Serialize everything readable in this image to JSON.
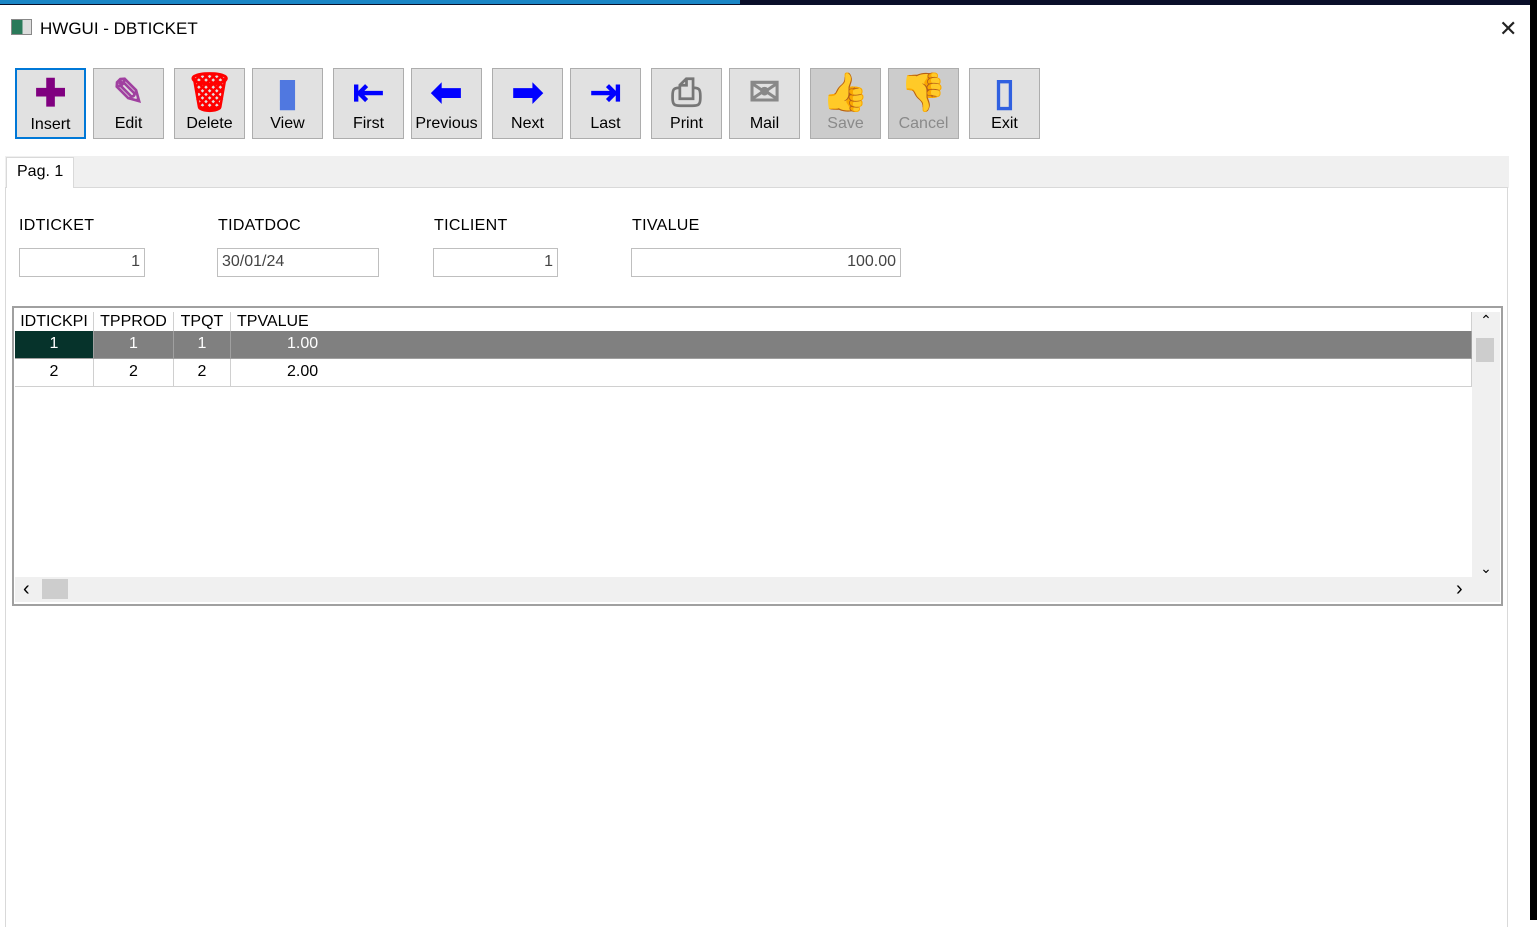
{
  "window": {
    "title": "HWGUI - DBTICKET",
    "close": "✕"
  },
  "toolbar": [
    {
      "label": "Insert",
      "icon": "plus-icon",
      "glyph": "✚",
      "color": "#800080"
    },
    {
      "label": "Edit",
      "icon": "edit-notepad-icon",
      "glyph": "✎",
      "color": "#a040a0"
    },
    {
      "label": "Delete",
      "icon": "trash-icon",
      "glyph": "🗑",
      "color": "#ff0000"
    },
    {
      "label": "View",
      "icon": "book-icon",
      "glyph": "▮",
      "color": "#5078e0"
    },
    {
      "label": "First",
      "icon": "first-arrow-icon",
      "glyph": "⇤",
      "color": "#0000ff"
    },
    {
      "label": "Previous",
      "icon": "left-arrow-icon",
      "glyph": "⬅",
      "color": "#0000ff"
    },
    {
      "label": "Next",
      "icon": "right-arrow-icon",
      "glyph": "➡",
      "color": "#0000ff"
    },
    {
      "label": "Last",
      "icon": "last-arrow-icon",
      "glyph": "⇥",
      "color": "#0000ff"
    },
    {
      "label": "Print",
      "icon": "printer-icon",
      "glyph": "⎙",
      "color": "#777777"
    },
    {
      "label": "Mail",
      "icon": "envelope-icon",
      "glyph": "✉",
      "color": "#888888"
    },
    {
      "label": "Save",
      "icon": "thumbs-up-icon",
      "glyph": "👍",
      "color": "#a868a8"
    },
    {
      "label": "Cancel",
      "icon": "thumbs-down-icon",
      "glyph": "👎",
      "color": "#a868a8"
    },
    {
      "label": "Exit",
      "icon": "door-icon",
      "glyph": "▯",
      "color": "#3060e0"
    }
  ],
  "tabs": [
    {
      "label": "Pag. 1"
    }
  ],
  "fields": [
    {
      "label": "IDTICKET",
      "value": "1"
    },
    {
      "label": "TIDATDOC",
      "value": "30/01/24"
    },
    {
      "label": "TICLIENT",
      "value": "1"
    },
    {
      "label": "TIVALUE",
      "value": "100.00"
    }
  ],
  "grid": {
    "columns": [
      "IDTICKPI",
      "TPPROD",
      "TPQT",
      "TPVALUE"
    ],
    "rows": [
      [
        "1",
        "1",
        "1",
        "1.00"
      ],
      [
        "2",
        "2",
        "2",
        "2.00"
      ]
    ],
    "scroll": {
      "up": "⌃",
      "down": "⌄",
      "left": "‹",
      "right": "›"
    }
  }
}
